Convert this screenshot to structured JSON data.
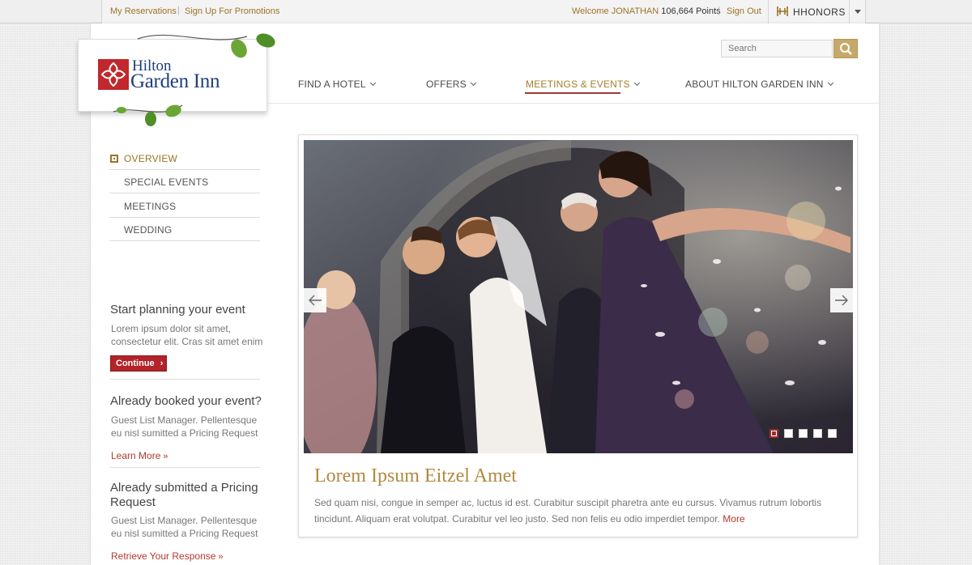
{
  "topbar": {
    "reservations": "My Reservations",
    "signup": "Sign Up For Promotions",
    "welcome_prefix": "Welcome",
    "user_name": "JONATHAN",
    "points": "106,664 Points",
    "signout": "Sign Out",
    "hhonors": "HHONORS"
  },
  "brand": {
    "line1": "Hilton",
    "line2": "Garden Inn",
    "accent": "#c0282d",
    "navy": "#1f3f7a"
  },
  "search": {
    "placeholder": "Search"
  },
  "nav": {
    "items": [
      {
        "label": "FIND A HOTEL"
      },
      {
        "label": "OFFERS"
      },
      {
        "label": "MEETINGS & EVENTS"
      },
      {
        "label": "ABOUT HILTON GARDEN INN"
      }
    ],
    "active_index": 2
  },
  "sidebar": {
    "items": [
      {
        "label": "OVERVIEW"
      },
      {
        "label": "SPECIAL EVENTS"
      },
      {
        "label": "MEETINGS"
      },
      {
        "label": "WEDDING"
      }
    ]
  },
  "promos": [
    {
      "title": "Start planning your event",
      "text": "Lorem ipsum dolor sit amet, consectetur elit. Cras sit amet enim",
      "link": "Continue"
    },
    {
      "title": "Already booked your event?",
      "text": "Guest List Manager. Pellentesque eu nisl sumitted a Pricing Request",
      "link": "Learn More"
    },
    {
      "title": "Already submitted a Pricing Request",
      "text": "Guest List Manager. Pellentesque eu nisl sumitted a Pricing Request",
      "link": "Retrieve Your Response"
    }
  ],
  "hero": {
    "heading": "Lorem Ipsum Eitzel Amet",
    "body": "Sed quam nisi, congue in semper ac, luctus id est. Curabitur suscipit pharetra ante eu cursus. Vivamus rutrum lobortis tincidunt. Aliquam erat volutpat. Curabitur vel leo justo. Sed non felis eu odio imperdiet tempor.",
    "more": "More",
    "slides_total": 5,
    "slide_active": 1
  }
}
